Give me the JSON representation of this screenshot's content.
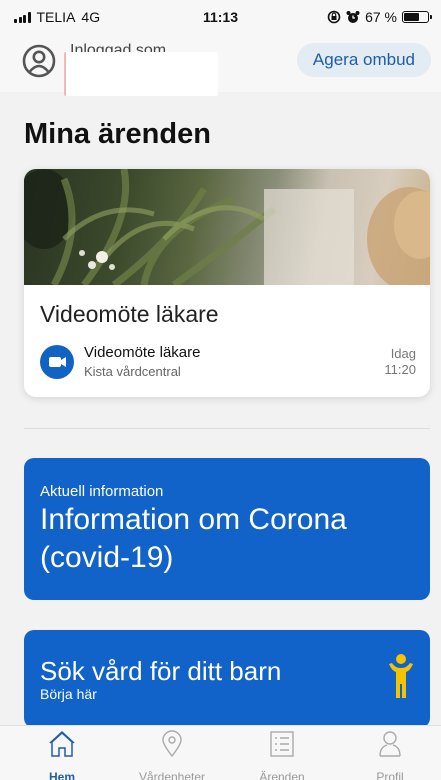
{
  "status_bar": {
    "carrier": "TELIA",
    "network": "4G",
    "time": "11:13",
    "battery_percent": "67 %",
    "battery_level": 0.67,
    "icons": [
      "signal-icon",
      "lock-rotation-icon",
      "alarm-icon",
      "battery-icon"
    ]
  },
  "header": {
    "logged_in_label": "Inloggad som",
    "avatar_icon": "person-circle-icon",
    "agent_button": "Agera ombud"
  },
  "page_title": "Mina ärenden",
  "case_card": {
    "title": "Videomöte läkare",
    "appointment": {
      "icon": "video-camera-icon",
      "title": "Videomöte läkare",
      "clinic": "Kista vårdcentral",
      "day": "Idag",
      "time": "11:20"
    }
  },
  "info_card": {
    "kicker": "Aktuell information",
    "title": "Information om Corona (covid-19)"
  },
  "child_card": {
    "title": "Sök vård för ditt barn",
    "subtitle": "Börja här",
    "icon": "child-icon",
    "icon_color": "#f5c400"
  },
  "tabbar": {
    "items": [
      {
        "label": "Hem",
        "icon": "home-icon",
        "active": true
      },
      {
        "label": "Vårdenheter",
        "icon": "location-pin-icon",
        "active": false
      },
      {
        "label": "Ärenden",
        "icon": "list-icon",
        "active": false
      },
      {
        "label": "Profil",
        "icon": "profile-icon",
        "active": false
      }
    ]
  },
  "colors": {
    "primary_blue": "#1162c9",
    "link_blue": "#1d5fa8",
    "background": "#f2f2f2"
  }
}
